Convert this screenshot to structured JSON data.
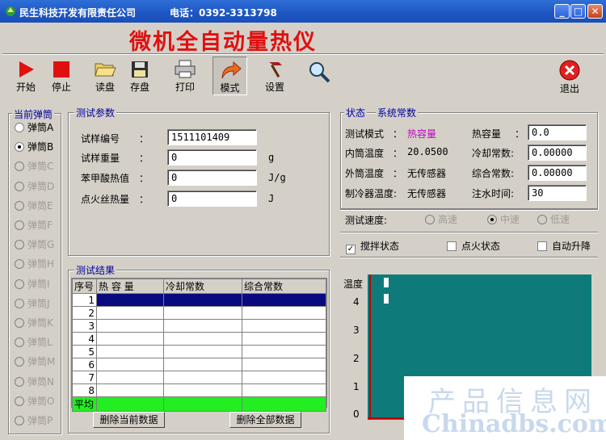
{
  "window": {
    "company": "民生科技开发有限责任公司",
    "phone": "电话：0392-3313798"
  },
  "app_title": "微机全自动量热仪",
  "toolbar": {
    "start": "开始",
    "stop": "停止",
    "read": "读盘",
    "save": "存盘",
    "print": "打印",
    "mode": "模式",
    "settings": "设置",
    "exit": "退出"
  },
  "bomb": {
    "title": "当前弹筒",
    "items": [
      "弹筒A",
      "弹筒B",
      "弹筒C",
      "弹筒D",
      "弹筒E",
      "弹筒F",
      "弹筒G",
      "弹筒H",
      "弹筒I",
      "弹筒J",
      "弹筒K",
      "弹筒L",
      "弹筒M",
      "弹筒N",
      "弹筒O",
      "弹筒P"
    ],
    "selected_index": 1
  },
  "params": {
    "title": "测试参数",
    "sample_no_label": "试样编号",
    "sample_no": "1511101409",
    "sample_weight_label": "试样重量",
    "sample_weight": "0",
    "sample_weight_unit": "g",
    "benzoic_label": "苯甲酸热值",
    "benzoic": "0",
    "benzoic_unit": "J/g",
    "ignition_label": "点火丝热量",
    "ignition": "0",
    "ignition_unit": "J",
    "colon": "："
  },
  "results": {
    "title": "测试结果",
    "headers": [
      "序号",
      "热 容 量",
      "冷却常数",
      "综合常数"
    ],
    "rows": [
      "1",
      "2",
      "3",
      "4",
      "5",
      "6",
      "7",
      "8"
    ],
    "avg_label": "平均",
    "delete_current": "删除当前数据",
    "delete_all": "删除全部数据"
  },
  "status": {
    "title": "状态",
    "constants_title": "系统常数",
    "mode_label": "测试模式",
    "mode_value": "热容量",
    "inner_temp_label": "内筒温度",
    "inner_temp_value": "20.0500",
    "outer_temp_label": "外筒温度",
    "outer_temp_value": "无传感器",
    "cooler_temp_label": "制冷器温度:",
    "cooler_temp_value": "无传感器",
    "heat_cap_label": "热容量",
    "heat_cap_value": "0.0",
    "cooling_label": "冷却常数:",
    "cooling_value": "0.00000",
    "composite_label": "综合常数:",
    "composite_value": "0.00000",
    "water_time_label": "注水时间:",
    "water_time_value": "30",
    "colon": "："
  },
  "speed": {
    "label": "测试速度:",
    "options": [
      "高速",
      "中速",
      "低速"
    ],
    "selected_index": 1
  },
  "checks": {
    "stir": "搅拌状态",
    "stir_checked": true,
    "ignite": "点火状态",
    "ignite_checked": false,
    "auto_rise": "自动升降",
    "auto_rise_checked": false
  },
  "chart_data": {
    "type": "line",
    "ylabel": "温度",
    "y_ticks": [
      "4",
      "3",
      "2",
      "1",
      "0"
    ],
    "ylim": [
      0,
      4
    ],
    "series": [],
    "colors": {
      "background": "#0e7a7a",
      "axis": "#c00000"
    }
  },
  "watermark": {
    "line1": "产品信息网",
    "line2": "Chinadbs.com"
  }
}
